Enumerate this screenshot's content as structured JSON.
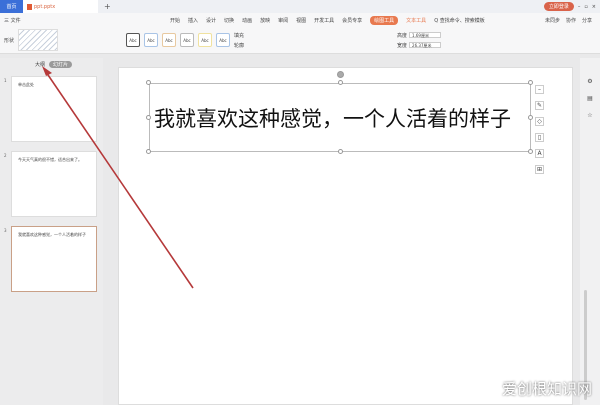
{
  "titlebar": {
    "home_tab": "首页",
    "doc_tab": "ppt.pptx",
    "login": "立即登录"
  },
  "menubar": {
    "left": [
      "三 文件",
      "▾"
    ],
    "tabs": [
      "开始",
      "插入",
      "设计",
      "切换",
      "动画",
      "放映",
      "审阅",
      "视图",
      "开发工具",
      "会员专享"
    ],
    "active_tab": "绘图工具",
    "text_tab": "文本工具",
    "search": "Q 查找命令、搜索模板",
    "right": [
      "未同步",
      "协作",
      "分享"
    ]
  },
  "ribbon": {
    "gallery_label": "形状",
    "fill": "填充",
    "outline": "轮廓",
    "styles": [
      "Abc",
      "Abc",
      "Abc",
      "Abc",
      "Abc",
      "Abc"
    ],
    "height_label": "高度",
    "height_value": "1.69厘米",
    "width_label": "宽度",
    "width_value": "26.37厘米"
  },
  "panel": {
    "tabs": [
      "大纲",
      "幻灯片"
    ]
  },
  "slides": [
    {
      "num": "1",
      "text": "单击此处"
    },
    {
      "num": "2",
      "text": "今天天气真的很不错，适合出来了。"
    },
    {
      "num": "3",
      "text": "我就喜欢这种感觉，一个人活着的样子"
    }
  ],
  "slide": {
    "title": "我就喜欢这种感觉，一个人活着的样子"
  },
  "watermark": "爱创根知识网",
  "colors": {
    "accent": "#e8794f",
    "arrow": "#b5393a",
    "home": "#3b6fd8"
  }
}
